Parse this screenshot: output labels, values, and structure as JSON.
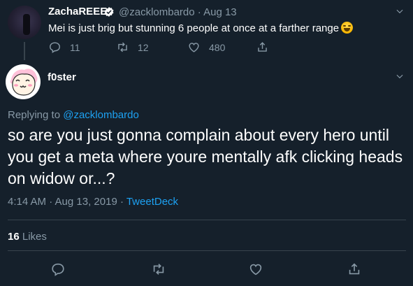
{
  "parent_tweet": {
    "display_name": "ZachaREEE",
    "meta": "@zacklombardo · Aug 13",
    "text": "Mei is just brig but stunning 6 people at once at a farther range",
    "replies": "11",
    "retweets": "12",
    "likes": "480"
  },
  "main_tweet": {
    "display_name": "f0ster",
    "replying_prefix": "Replying to ",
    "replying_to": "@zacklombardo",
    "text": "so are you just gonna complain about every hero until you get a meta where youre mentally afk clicking heads on widow or...?",
    "timestamp": "4:14 AM · Aug 13, 2019 · ",
    "source": "TweetDeck",
    "likes_count": "16",
    "likes_label": "Likes"
  },
  "colors": {
    "background": "#15202b",
    "text": "#ffffff",
    "secondary": "#8899a6",
    "accent": "#1da1f2",
    "divider": "#38444d"
  },
  "icons": [
    "verified-icon",
    "chevron-down-icon",
    "reply-icon",
    "retweet-icon",
    "like-icon",
    "share-icon",
    "laughing-emoji"
  ]
}
